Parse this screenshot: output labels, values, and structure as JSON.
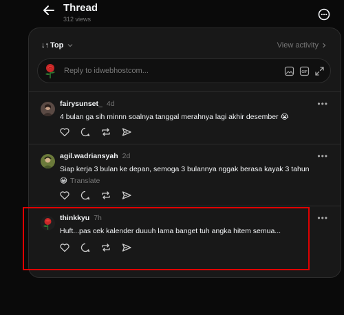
{
  "header": {
    "title": "Thread",
    "views": "312 views"
  },
  "sort": {
    "label": "Top",
    "view_activity": "View activity"
  },
  "reply": {
    "placeholder": "Reply to idwebhostcom..."
  },
  "posts": [
    {
      "username": "fairysunset_",
      "time": "4d",
      "text": "4 bulan ga sih minnn soalnya tanggal merahnya lagi akhir desember 😭"
    },
    {
      "username": "agil.wadriansyah",
      "time": "2d",
      "text": "Siap kerja 3 bulan ke depan, semoga 3 bulannya nggak berasa kayak 3 tahun",
      "text2": "😁",
      "translate": "Translate"
    },
    {
      "username": "thinkkyu",
      "time": "7h",
      "text": "Huft...pas cek kalender duuuh lama banget tuh angka hitem semua..."
    }
  ],
  "highlight_color": "#e00000"
}
